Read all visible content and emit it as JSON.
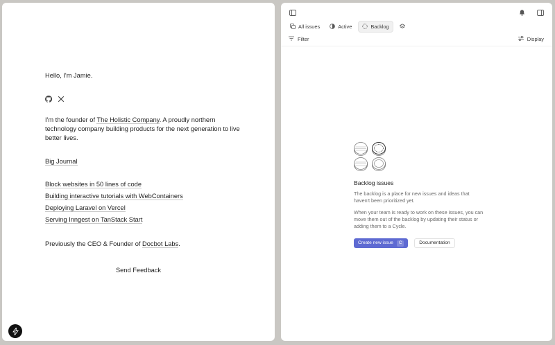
{
  "left": {
    "greeting": "Hello, I'm Jamie.",
    "bio_prefix": "I'm the founder of ",
    "bio_link": "The Holistic Company",
    "bio_suffix": ". A proudly northern technology company building products for the next generation to live better lives.",
    "journal": "Big Journal",
    "posts": [
      "Block websites in 50 lines of code",
      "Building interactive tutorials with WebContainers",
      "Deploying Laravel on Vercel",
      "Serving Inngest on TanStack Start"
    ],
    "previously_prefix": "Previously the CEO & Founder of ",
    "previously_link": "Docbot Labs",
    "previously_suffix": ".",
    "feedback": "Send Feedback"
  },
  "right": {
    "tabs": [
      {
        "label": "All issues",
        "icon": "issues-icon"
      },
      {
        "label": "Active",
        "icon": "half-circle-icon"
      },
      {
        "label": "Backlog",
        "icon": "dashed-circle-icon"
      }
    ],
    "filter_label": "Filter",
    "display_label": "Display",
    "empty_title": "Backlog issues",
    "empty_p1": "The backlog is a place for new issues and ideas that haven't been prioritized yet.",
    "empty_p2": "When your team is ready to work on these issues, you can move them out of the backlog by updating their status or adding them to a Cycle.",
    "create_label": "Create new issue",
    "create_shortcut": "C",
    "docs_label": "Documentation"
  },
  "colors": {
    "accent": "#5e6ad2",
    "frame": "#c9c7c3"
  }
}
